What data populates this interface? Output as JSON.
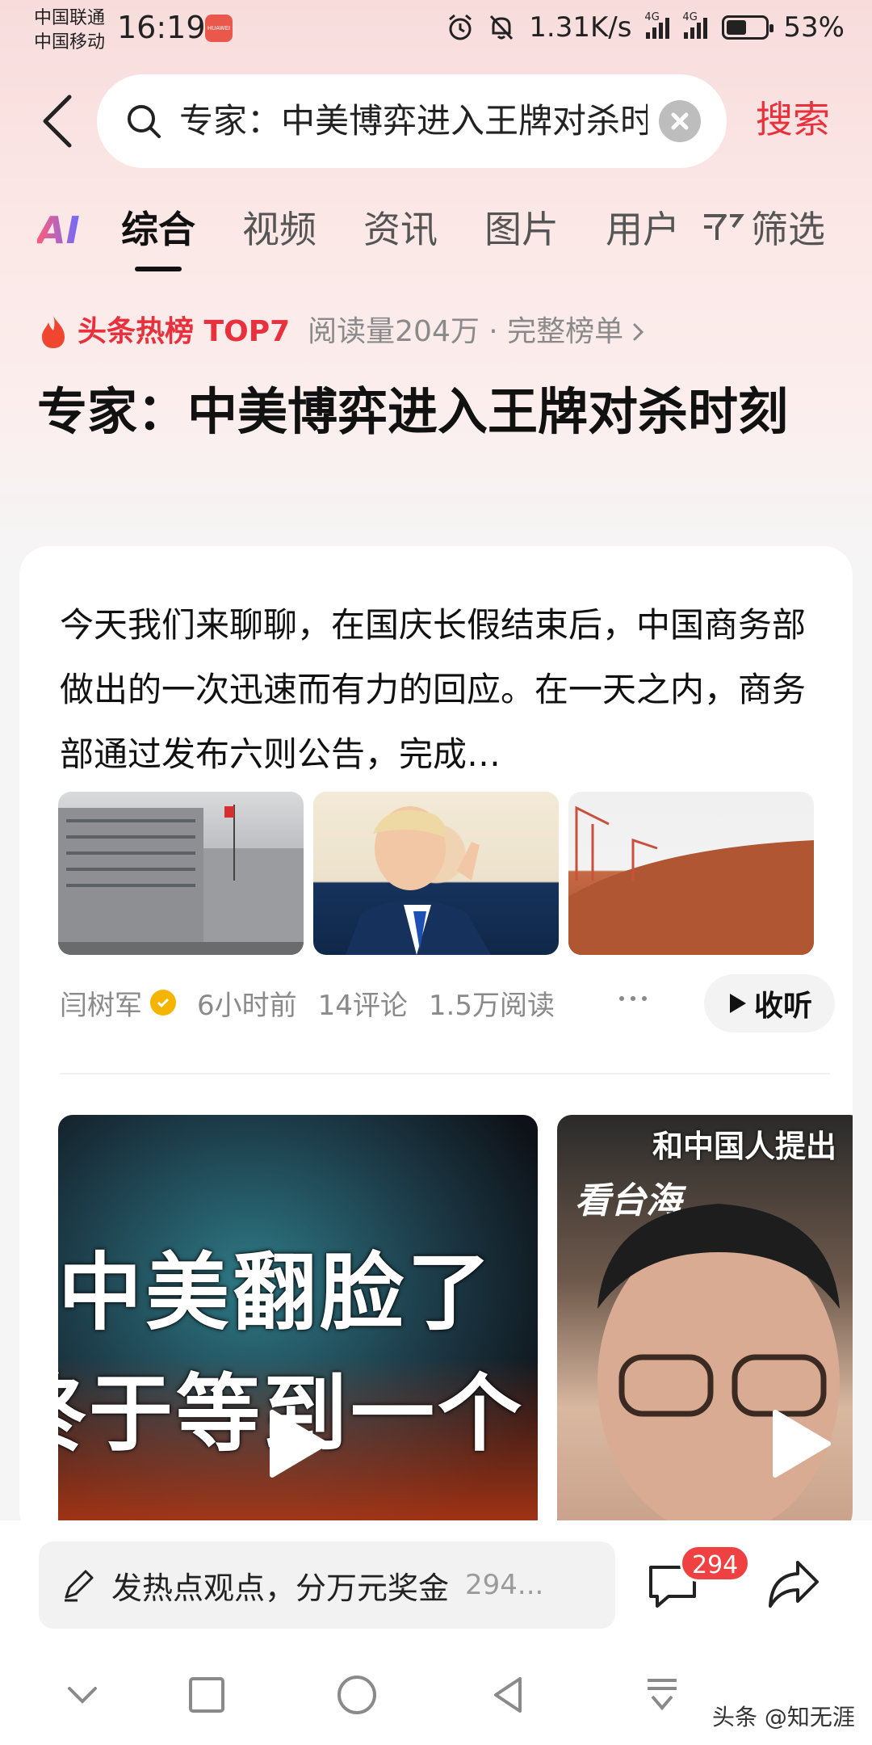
{
  "status_bar": {
    "carrier_1": "中国联通",
    "carrier_2": "中国移动",
    "time": "16:19",
    "app_badge": "HUAWEI",
    "net_speed": "1.31K/s",
    "network_1": "4G",
    "network_2": "4G",
    "battery": "53%",
    "battery_level": 0.53,
    "icons": [
      "alarm-icon",
      "mute-icon",
      "signal-icon",
      "battery-icon"
    ]
  },
  "search": {
    "query": "专家：中美博弈进入王牌对杀时刻",
    "submit_label": "搜索"
  },
  "tabs": {
    "ai": "AI",
    "items": [
      "综合",
      "视频",
      "资讯",
      "图片",
      "用户"
    ],
    "active_index": 0,
    "filter": "筛选"
  },
  "hot": {
    "title": "头条热榜 TOP7",
    "meta": "阅读量204万 · 完整榜单"
  },
  "headline": "专家：中美博弈进入王牌对杀时刻",
  "article": {
    "text": "今天我们来聊聊，在国庆长假结束后，中国商务部做出的一次迅速而有力的回应。在一天之内，商务部通过发布六则公告，完成…",
    "author": "闫树军",
    "time": "6小时前",
    "comments": "14评论",
    "reads": "1.5万阅读",
    "listen_label": "收听"
  },
  "videos": {
    "v1_line_1": "中美翻脸了",
    "v1_line_2": "终于等到一个",
    "v2_caption": "和中国人提出",
    "v2_logo": "看台海"
  },
  "comment_bar": {
    "placeholder": "发热点观点，分万元奖金",
    "inline_count": "294...",
    "badge": "294"
  },
  "watermark": "头条 @知无涯",
  "colors": {
    "accent_red": "#e8313c",
    "badge_red": "#f04142",
    "verified": "#f4b400"
  }
}
